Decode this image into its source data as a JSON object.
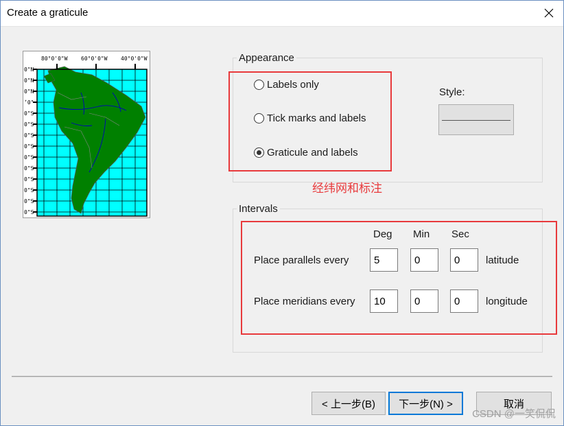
{
  "window": {
    "title": "Create a graticule"
  },
  "preview": {
    "top_labels": [
      "80°0'0\"W",
      "60°0'0\"W",
      "40°0'0\"W"
    ],
    "side_labels": [
      "0\"N",
      "0\"N",
      "0\"N",
      "ʼ0\"",
      "0\"S",
      "0\"S",
      "0\"S",
      "0\"S",
      "0\"S",
      "0\"S",
      "0\"S",
      "0\"S",
      "0\"S",
      "0\"S",
      "0\"S"
    ],
    "colors": {
      "ocean": "#00ffff",
      "land": "#008000",
      "grid": "#000000",
      "rivers": "#0000c0"
    }
  },
  "appearance": {
    "label": "Appearance",
    "options": [
      {
        "label": "Labels only",
        "checked": false
      },
      {
        "label": "Tick marks and labels",
        "checked": false
      },
      {
        "label": "Graticule and labels",
        "checked": true
      }
    ],
    "style_label": "Style:"
  },
  "annotation": {
    "text": "经纬网和标注",
    "color": "#e8393b"
  },
  "intervals": {
    "label": "Intervals",
    "columns": [
      "Deg",
      "Min",
      "Sec"
    ],
    "rows": [
      {
        "label": "Place parallels every",
        "deg": "5",
        "min": "0",
        "sec": "0",
        "unit": "latitude"
      },
      {
        "label": "Place meridians every",
        "deg": "10",
        "min": "0",
        "sec": "0",
        "unit": "longitude"
      }
    ]
  },
  "buttons": {
    "back": "< 上一步(B)",
    "next": "下一步(N) >",
    "cancel": "取消"
  },
  "watermark": "CSDN @一笑侃侃"
}
